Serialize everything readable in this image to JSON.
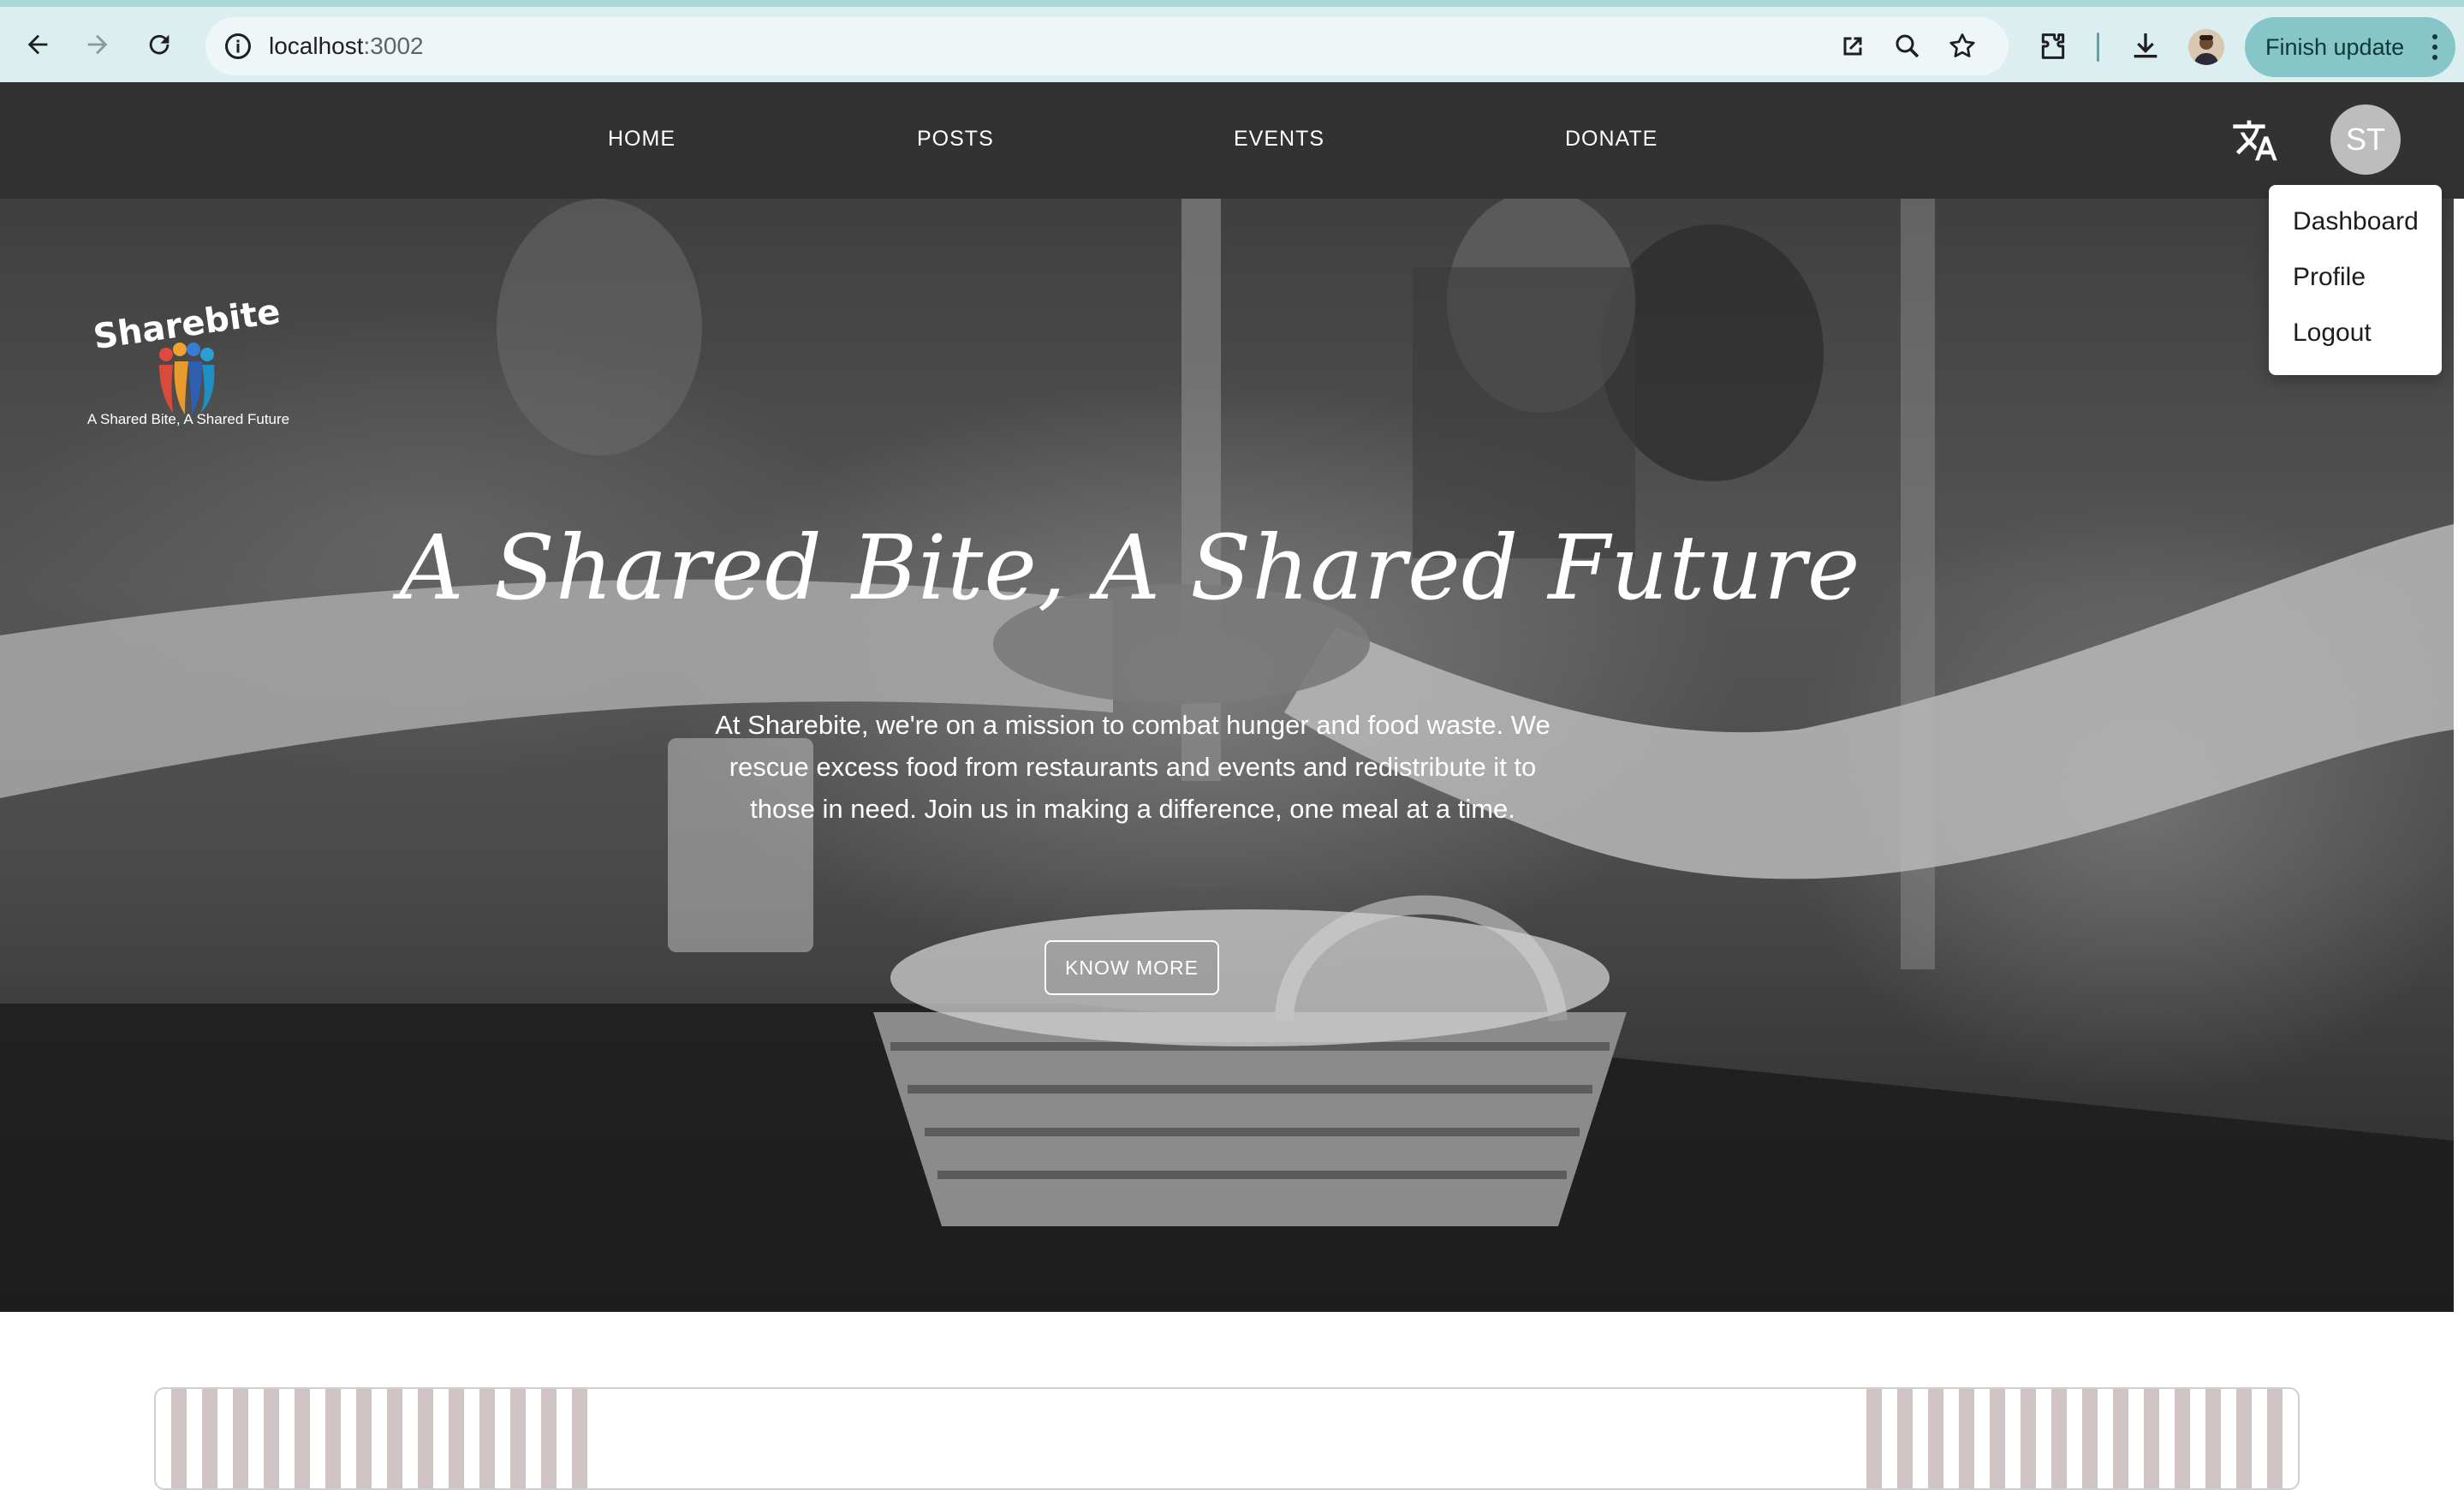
{
  "browser": {
    "url_host": "localhost",
    "url_port": ":3002",
    "finish_update_label": "Finish update",
    "icons": [
      "back-icon",
      "forward-icon",
      "reload-icon",
      "site-info-icon",
      "open-in-new-icon",
      "zoom-icon",
      "bookmark-star-icon",
      "extensions-icon",
      "download-icon",
      "profile-avatar",
      "more-vert-icon"
    ]
  },
  "nav": {
    "links": [
      "HOME",
      "POSTS",
      "EVENTS",
      "DONATE"
    ],
    "avatar_initials": "ST"
  },
  "hero": {
    "tagline": "A Shared Bite, A Shared Future",
    "title": "A Shared Bite, A Shared Future",
    "description": "At Sharebite, we're on a mission to combat hunger and food waste. We rescue excess food from restaurants and events and redistribute it to those in need. Join us in making a difference, one meal at a time.",
    "cta_label": "KNOW MORE",
    "logo_text": "Sharebite"
  },
  "user_menu": {
    "items": [
      "Dashboard",
      "Profile",
      "Logout"
    ]
  },
  "colors": {
    "chrome_bg": "#dbeff1",
    "nav_bg": "#323232",
    "update_button": "#86c6c8",
    "stripe": "#cfc3c3"
  }
}
